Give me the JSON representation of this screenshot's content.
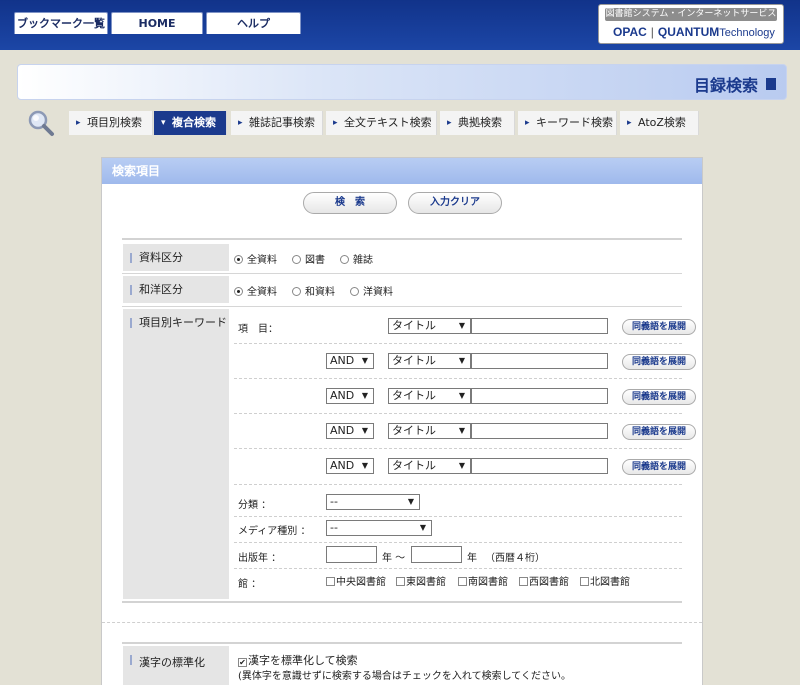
{
  "topnav": {
    "bookmarks": "ブックマーク一覧",
    "home": "HOME",
    "help": "ヘルプ"
  },
  "brand": {
    "subtitle": "図書館システム・インターネットサービス",
    "opac": "OPAC",
    "quantum": "QUANTUM",
    "technology": "Technology"
  },
  "page_title": "目録検索",
  "tabs": [
    "項目別検索",
    "複合検索",
    "雑誌記事検索",
    "全文テキスト検索",
    "典拠検索",
    "キーワード検索",
    "AtoZ検索"
  ],
  "active_tab": "複合検索",
  "panel": {
    "header": "検索項目",
    "search_button": "検　索",
    "clear_button": "入力クリア"
  },
  "material_type": {
    "label": "資料区分",
    "options": [
      "全資料",
      "図書",
      "雑誌"
    ],
    "selected": "全資料"
  },
  "lang_type": {
    "label": "和洋区分",
    "options": [
      "全資料",
      "和資料",
      "洋資料"
    ],
    "selected": "全資料"
  },
  "keyword": {
    "label": "項目別キーワード",
    "item_label": "項　目：",
    "field_default": "タイトル",
    "operator_default": "AND",
    "synonym_button": "同義語を展開"
  },
  "classification": {
    "label": "分類 ：",
    "value": "--"
  },
  "media": {
    "label": "メディア種別 ：",
    "value": "--"
  },
  "pub_year": {
    "label": "出版年 ：",
    "year1": "年 ～",
    "year2": "年",
    "note": "（西暦４桁）"
  },
  "library": {
    "label": "館 ：",
    "options": [
      "中央図書館",
      "東図書館",
      "南図書館",
      "西図書館",
      "北図書館"
    ]
  },
  "kanji": {
    "label": "漢字の標準化",
    "checkbox_label": "漢字を標準化して検索",
    "note": "(異体字を意識せずに検索する場合はチェックを入れて検索してください。"
  }
}
